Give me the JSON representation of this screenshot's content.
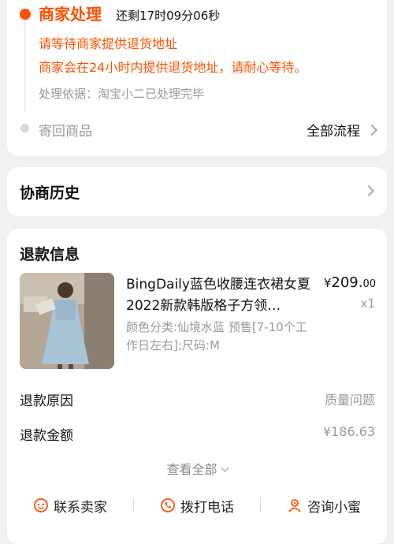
{
  "status": {
    "title": "商家处理",
    "countdown": "还剩17时09分06秒",
    "notice_1": "请等待商家提供退货地址",
    "notice_2": "商家会在24小时内提供退货地址，请耐心等待。",
    "basis": "处理依据：淘宝小二已处理完毕",
    "next_step": "寄回商品",
    "all_flow_label": "全部流程",
    "accent_color": "#ff5000"
  },
  "history": {
    "title": "协商历史"
  },
  "refund": {
    "title": "退款信息",
    "product": {
      "title": "BingDaily蓝色收腰连衣裙女夏2022新款韩版格子方领…",
      "spec": "颜色分类:仙境水蓝 预售[7-10个工作日左右];尺码:M",
      "price_symbol": "¥",
      "price_int": "209.",
      "price_dec": "00",
      "quantity": "x1"
    },
    "reason_label": "退款原因",
    "reason_value": "质量问题",
    "amount_label": "退款金额",
    "amount_value": "¥186.63",
    "view_all": "查看全部"
  },
  "actions": {
    "contact_seller": "联系卖家",
    "call": "拨打电话",
    "consult": "咨询小蜜"
  }
}
